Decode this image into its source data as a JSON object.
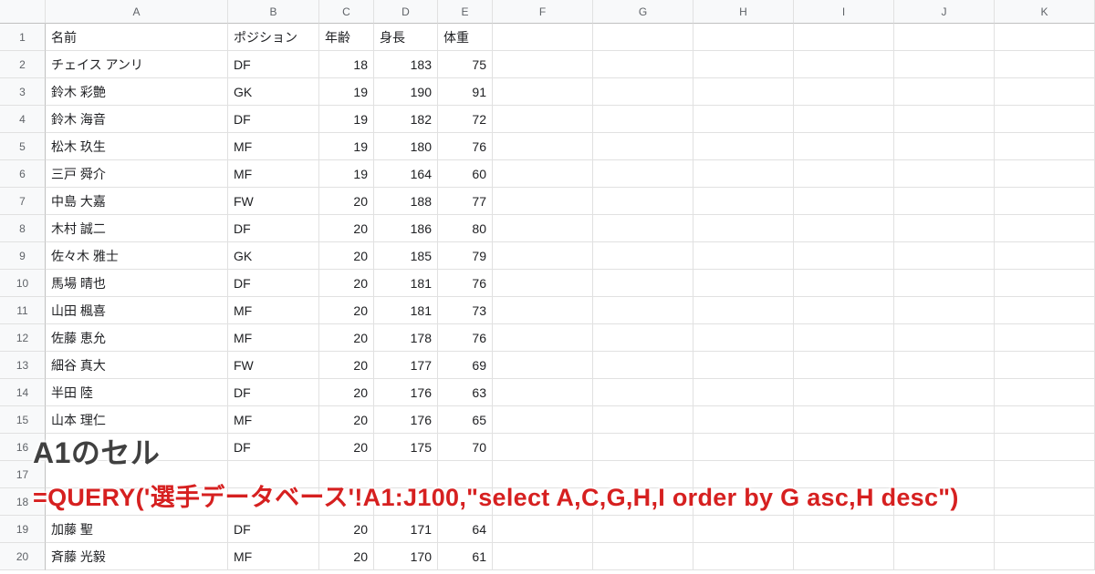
{
  "columns": [
    "A",
    "B",
    "C",
    "D",
    "E",
    "F",
    "G",
    "H",
    "I",
    "J",
    "K"
  ],
  "headers": {
    "A": "名前",
    "B": "ポジション",
    "C": "年齢",
    "D": "身長",
    "E": "体重"
  },
  "rows": [
    {
      "A": "チェイス アンリ",
      "B": "DF",
      "C": "18",
      "D": "183",
      "E": "75"
    },
    {
      "A": "鈴木 彩艶",
      "B": "GK",
      "C": "19",
      "D": "190",
      "E": "91"
    },
    {
      "A": "鈴木 海音",
      "B": "DF",
      "C": "19",
      "D": "182",
      "E": "72"
    },
    {
      "A": "松木 玖生",
      "B": "MF",
      "C": "19",
      "D": "180",
      "E": "76"
    },
    {
      "A": "三戸 舜介",
      "B": "MF",
      "C": "19",
      "D": "164",
      "E": "60"
    },
    {
      "A": "中島 大嘉",
      "B": "FW",
      "C": "20",
      "D": "188",
      "E": "77"
    },
    {
      "A": "木村 誠二",
      "B": "DF",
      "C": "20",
      "D": "186",
      "E": "80"
    },
    {
      "A": "佐々木 雅士",
      "B": "GK",
      "C": "20",
      "D": "185",
      "E": "79"
    },
    {
      "A": "馬場 晴也",
      "B": "DF",
      "C": "20",
      "D": "181",
      "E": "76"
    },
    {
      "A": "山田 楓喜",
      "B": "MF",
      "C": "20",
      "D": "181",
      "E": "73"
    },
    {
      "A": "佐藤 恵允",
      "B": "MF",
      "C": "20",
      "D": "178",
      "E": "76"
    },
    {
      "A": "細谷 真大",
      "B": "FW",
      "C": "20",
      "D": "177",
      "E": "69"
    },
    {
      "A": "半田 陸",
      "B": "DF",
      "C": "20",
      "D": "176",
      "E": "63"
    },
    {
      "A": "山本 理仁",
      "B": "MF",
      "C": "20",
      "D": "176",
      "E": "65"
    },
    {
      "A": "",
      "B": "DF",
      "C": "20",
      "D": "175",
      "E": "70"
    },
    {
      "A": "",
      "B": "",
      "C": "",
      "D": "",
      "E": ""
    },
    {
      "A": "",
      "B": "",
      "C": "",
      "D": "",
      "E": ""
    },
    {
      "A": "加藤 聖",
      "B": "DF",
      "C": "20",
      "D": "171",
      "E": "64"
    },
    {
      "A": "斉藤 光毅",
      "B": "MF",
      "C": "20",
      "D": "170",
      "E": "61"
    }
  ],
  "numericCols": [
    "C",
    "D",
    "E"
  ],
  "annotation": "A1のセル",
  "formula": "=QUERY('選手データベース'!A1:J100,\"select A,C,G,H,I order by G asc,H desc\")"
}
